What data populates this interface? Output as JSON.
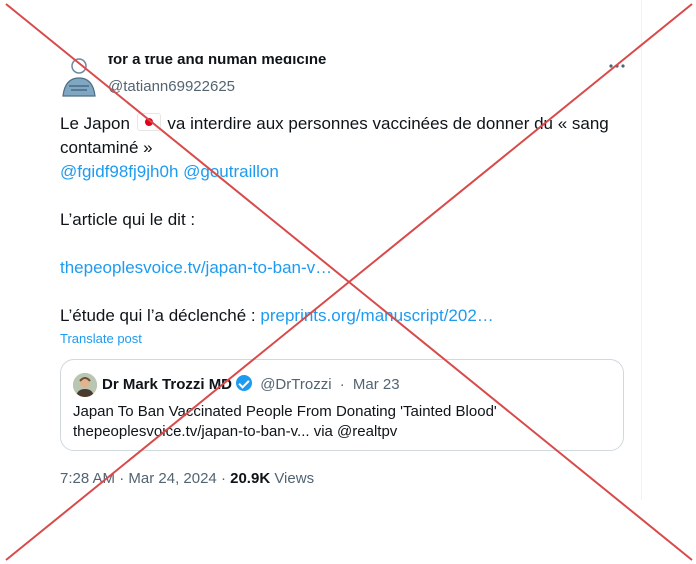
{
  "post": {
    "author_display_name": "for a true and human medicine",
    "author_handle": "@tatiann69922625",
    "text_line1_before_flag": "Le Japon",
    "text_line1_after_flag": "va interdire aux personnes vaccinées de donner du « sang",
    "text_line2": "contaminé »",
    "mention_1": "@fgidf98fj9jh0h",
    "mention_2": "@goutraillon",
    "article_label": "L’article qui le dit :",
    "article_link": "thepeoplesvoice.tv/japan-to-ban-v…",
    "study_label": "L’étude qui l’a déclenché :",
    "study_link": "preprints.org/manuscript/202…",
    "translate_label": "Translate post",
    "time": "7:28 AM",
    "date": "Mar 24, 2024",
    "views_count": "20.9K",
    "views_label": "Views"
  },
  "quoted_post": {
    "author_name": "Dr Mark Trozzi MD",
    "author_handle": "@DrTrozzi",
    "date": "Mar 23",
    "line1": "Japan To Ban Vaccinated People From Donating 'Tainted Blood'",
    "line2": "thepeoplesvoice.tv/japan-to-ban-v... via @realtpv"
  },
  "icons": {
    "flag": "japan-flag-icon",
    "verified": "verified-badge-icon",
    "more": "more-options-icon"
  },
  "colors": {
    "link": "#1d9bf0",
    "cross": "#d94a4a",
    "secondary_text": "#536471"
  }
}
